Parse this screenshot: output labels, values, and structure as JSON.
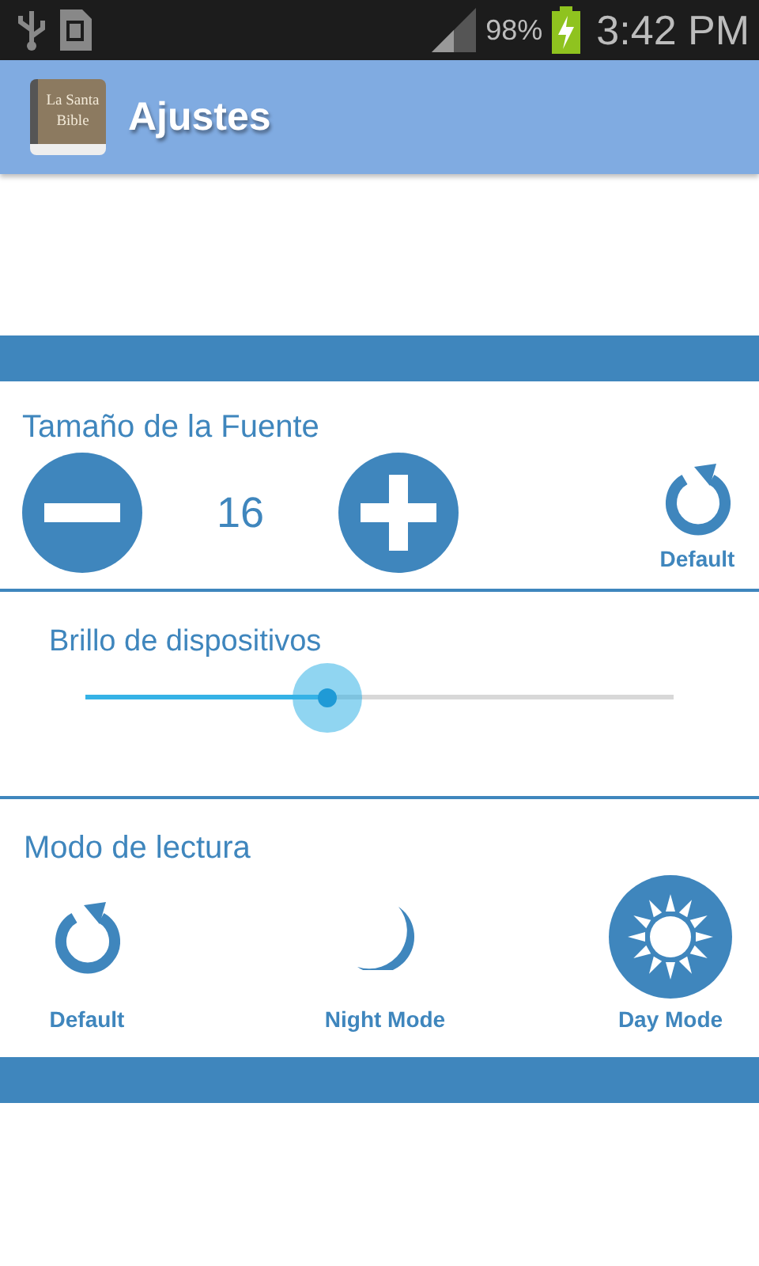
{
  "status_bar": {
    "battery": "98%",
    "time": "3:42 PM"
  },
  "app_bar": {
    "icon_text": "La Santa Bible",
    "title": "Ajustes"
  },
  "font_size": {
    "title": "Tamaño de la Fuente",
    "value": "16",
    "reset_label": "Default"
  },
  "brightness": {
    "title": "Brillo de dispositivos",
    "level": 0.41
  },
  "reading_mode": {
    "title": "Modo de lectura",
    "modes": [
      {
        "kind": "reset",
        "label": "Default",
        "selected": false
      },
      {
        "kind": "night",
        "label": "Night Mode",
        "selected": false
      },
      {
        "kind": "day",
        "label": "Day Mode",
        "selected": true
      }
    ]
  }
}
